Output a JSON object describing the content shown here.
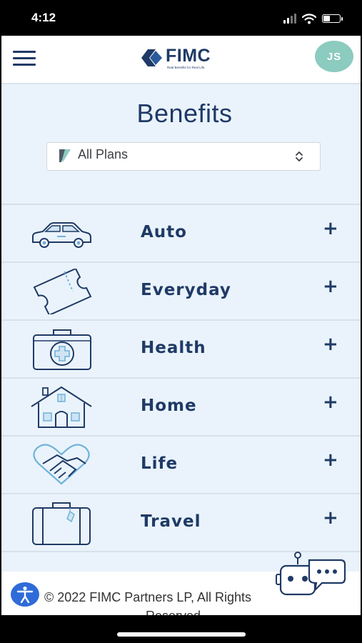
{
  "status_bar": {
    "time": "4:12"
  },
  "header": {
    "brand": {
      "name": "FIMC",
      "tagline": "Real Benefits for Real Life."
    },
    "avatar_initials": "JS"
  },
  "page": {
    "title": "Benefits",
    "plan_filter": {
      "selected": "All Plans"
    }
  },
  "categories": [
    {
      "label": "Auto",
      "icon": "car-icon",
      "expand": "+"
    },
    {
      "label": "Everyday",
      "icon": "ticket-icon",
      "expand": "+"
    },
    {
      "label": "Health",
      "icon": "medical-kit-icon",
      "expand": "+"
    },
    {
      "label": "Home",
      "icon": "house-icon",
      "expand": "+"
    },
    {
      "label": "Life",
      "icon": "heart-handshake-icon",
      "expand": "+"
    },
    {
      "label": "Travel",
      "icon": "suitcase-icon",
      "expand": "+"
    }
  ],
  "footer": {
    "copyright_line1": "© 2022 FIMC Partners LP, All Rights",
    "copyright_line2": "Reserved"
  },
  "colors": {
    "brand_navy": "#1f3a66",
    "brand_teal": "#8ccbbf",
    "accessibility_blue": "#2f6bd8",
    "page_background": "#eaf3fb"
  }
}
